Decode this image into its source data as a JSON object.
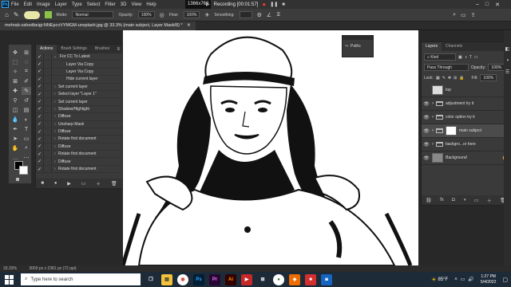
{
  "menubar": {
    "app_icon": "Ps",
    "items": [
      "File",
      "Edit",
      "Image",
      "Layer",
      "Type",
      "Select",
      "Filter",
      "3D",
      "View",
      "Help"
    ],
    "resolution": "1366x768",
    "recording": "Recording [00:01:57]"
  },
  "optionsbar": {
    "mode_label": "Mode:",
    "mode_value": "Normal",
    "opacity_label": "Opacity:",
    "opacity_value": "100%",
    "flow_label": "Flow:",
    "flow_value": "100%",
    "smoothing_label": "Smoothing:"
  },
  "document_tab": "mehrab-zahedbeigi-NNEpcvVYMGM-unsplash.jpg @ 33.3% (main subject, Layer Mask/8) *",
  "actions_panel": {
    "tabs": [
      "Actions",
      "Brush Settings",
      "Brushes"
    ],
    "items": [
      {
        "label": "For CC To Latest",
        "type": "set"
      },
      {
        "label": "Layer Via Copy",
        "type": "step"
      },
      {
        "label": "Layer Via Copy",
        "type": "step"
      },
      {
        "label": "Hide current layer",
        "type": "step"
      },
      {
        "label": "Set current layer",
        "type": "action"
      },
      {
        "label": "Select layer \"Layer 1\"",
        "type": "action"
      },
      {
        "label": "Set current layer",
        "type": "action"
      },
      {
        "label": "Shadow/Highlight",
        "type": "action"
      },
      {
        "label": "Diffuse",
        "type": "action"
      },
      {
        "label": "Unsharp Mask",
        "type": "action"
      },
      {
        "label": "Diffuse",
        "type": "action"
      },
      {
        "label": "Rotate first document",
        "type": "action"
      },
      {
        "label": "Diffuse",
        "type": "action"
      },
      {
        "label": "Rotate first document",
        "type": "action"
      },
      {
        "label": "Diffuse",
        "type": "action"
      },
      {
        "label": "Rotate first document",
        "type": "action"
      }
    ]
  },
  "paths_panel": {
    "label": "Paths"
  },
  "layers_panel": {
    "tabs": [
      "Layers",
      "Channels"
    ],
    "kind": "Kind",
    "blend": "Pass Through",
    "opacity_label": "Opacity:",
    "opacity_value": "100%",
    "lock_label": "Lock:",
    "fill_label": "Fill:",
    "fill_value": "100%",
    "layers": [
      {
        "name": "top",
        "type": "layer",
        "visible": false,
        "selected": false
      },
      {
        "name": "adjustment try it",
        "type": "group",
        "visible": true,
        "selected": false
      },
      {
        "name": "color option try it",
        "type": "group",
        "visible": true,
        "selected": false
      },
      {
        "name": "main subject",
        "type": "group",
        "visible": true,
        "selected": true
      },
      {
        "name": "backgro...or here",
        "type": "group",
        "visible": true,
        "selected": false
      },
      {
        "name": "Background",
        "type": "background",
        "visible": true,
        "selected": false
      }
    ]
  },
  "statusbar": {
    "zoom": "33.33%",
    "docinfo": "3000 px x 2381 px (72 ppi)"
  },
  "taskbar": {
    "search_placeholder": "Type here to search",
    "weather": "85°F",
    "time": "1:27 PM",
    "date": "5/4/2022"
  },
  "colors": {
    "accent": "#31a8ff",
    "panel": "#3a3a3a",
    "taskbar": "#1d2a38"
  }
}
